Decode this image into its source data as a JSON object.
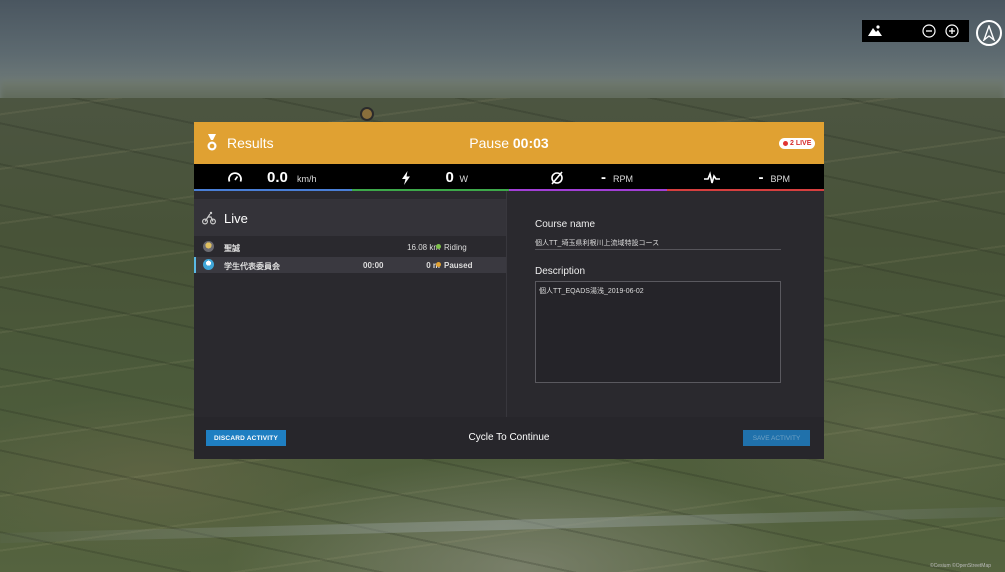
{
  "map": {
    "controls": {
      "terrain_icon": "terrain-icon",
      "zoom_out_icon": "zoom-out-icon",
      "zoom_in_icon": "zoom-in-icon",
      "compass_icon": "compass-north-icon"
    },
    "attribution": "©Cesium ©OpenStreetMap"
  },
  "results": {
    "header": {
      "title": "Results",
      "pause_label": "Pause",
      "pause_time": "00:03",
      "live_badge": "2 LIVE",
      "color": "#e0a132"
    },
    "metrics": [
      {
        "icon": "speedometer-icon",
        "value": "0.0",
        "unit": "km/h",
        "color": "#4a7fd6"
      },
      {
        "icon": "lightning-icon",
        "value": "0",
        "unit": "W",
        "color": "#3da84a"
      },
      {
        "icon": "cadence-icon",
        "value": "-",
        "unit": "RPM",
        "color": "#a23fd6"
      },
      {
        "icon": "heartbeat-icon",
        "value": "-",
        "unit": "BPM",
        "color": "#d63f3f"
      }
    ],
    "live": {
      "title": "Live",
      "riders": [
        {
          "name": "聖誠",
          "time": "",
          "distance": "16.08 km",
          "status": "Riding",
          "status_color": "#7ec04b",
          "selected": false
        },
        {
          "name": "学生代表委員会",
          "time": "00:00",
          "distance": "0 m",
          "status": "Paused",
          "status_color": "#e0a132",
          "selected": true
        }
      ]
    },
    "course": {
      "name_label": "Course name",
      "name_value": "個人TT_埼玉県利根川上流域特設コース",
      "description_label": "Description",
      "description_value": "個人TT_EQADS湯浅_2019-06-02"
    },
    "footer": {
      "discard_label": "DISCARD ACTIVITY",
      "cycle_label": "Cycle To Continue",
      "save_label": "SAVE ACTIVITY"
    }
  }
}
